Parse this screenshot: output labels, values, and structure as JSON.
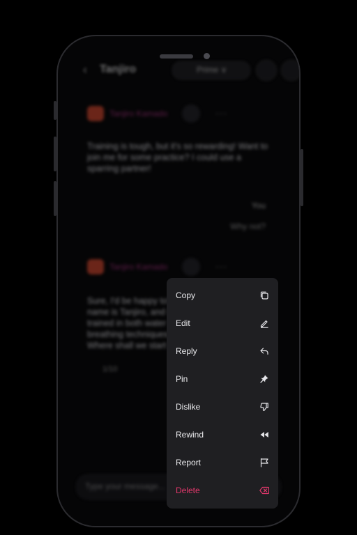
{
  "chat": {
    "back_glyph": "‹",
    "title": "Tanjiro",
    "model_pill": "Prime ∨",
    "messages": [
      {
        "author": "Tanjiro Kamado",
        "text": "Training is tough, but it's so rewarding! Want to join me for some practice? I could use a sparring partner!"
      },
      {
        "author": "You",
        "text": "Why not?"
      },
      {
        "author": "Tanjiro Kamado",
        "text": "Sure, I'd be happy to! My name is Tanjiro, and I've trained in both water breathing techniques. Where shall we start with?",
        "pager": "1/10"
      }
    ],
    "input_placeholder": "Type your message..."
  },
  "menu": {
    "items": [
      {
        "label": "Copy",
        "icon": "copy-icon"
      },
      {
        "label": "Edit",
        "icon": "pencil-icon"
      },
      {
        "label": "Reply",
        "icon": "reply-icon"
      },
      {
        "label": "Pin",
        "icon": "pin-icon"
      },
      {
        "label": "Dislike",
        "icon": "thumbs-down-icon"
      },
      {
        "label": "Rewind",
        "icon": "rewind-icon"
      },
      {
        "label": "Report",
        "icon": "flag-icon"
      },
      {
        "label": "Delete",
        "icon": "backspace-icon"
      }
    ],
    "colors": {
      "background": "#1f1f22",
      "text": "#ececef",
      "danger": "#e5386d"
    }
  }
}
